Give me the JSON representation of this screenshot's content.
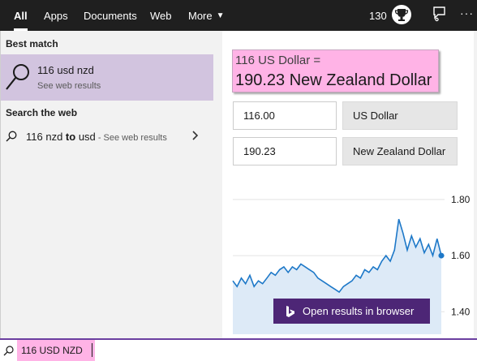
{
  "nav": {
    "tabs": [
      {
        "label": "All",
        "active": true
      },
      {
        "label": "Apps",
        "active": false
      },
      {
        "label": "Documents",
        "active": false
      },
      {
        "label": "Web",
        "active": false
      },
      {
        "label": "More",
        "active": false
      }
    ],
    "points": "130",
    "more_options": "···"
  },
  "left": {
    "best_match_title": "Best match",
    "best_item": {
      "title": "116 usd nzd",
      "subtitle": "See web results"
    },
    "search_web_title": "Search the web",
    "web_item": {
      "query_prefix": "116 nzd ",
      "query_bold": "to",
      "query_suffix": " usd",
      "subtitle": " - See web results"
    }
  },
  "converter": {
    "result_line1": "116 US Dollar =",
    "result_line2": "190.23 New Zealand Dollar",
    "from_amount": "116.00",
    "from_currency": "US Dollar",
    "to_amount": "190.23",
    "to_currency": "New Zealand Dollar"
  },
  "chart_data": {
    "type": "line",
    "title": "",
    "xlabel": "",
    "ylabel": "",
    "ylim": [
      1.32,
      1.84
    ],
    "yticks": [
      "1.80",
      "1.60",
      "1.40"
    ],
    "series": [
      {
        "values": [
          1.51,
          1.49,
          1.52,
          1.5,
          1.53,
          1.49,
          1.51,
          1.5,
          1.52,
          1.54,
          1.53,
          1.55,
          1.56,
          1.54,
          1.56,
          1.55,
          1.57,
          1.56,
          1.55,
          1.54,
          1.52,
          1.51,
          1.5,
          1.49,
          1.48,
          1.47,
          1.49,
          1.5,
          1.51,
          1.53,
          1.52,
          1.55,
          1.54,
          1.56,
          1.55,
          1.58,
          1.6,
          1.58,
          1.62,
          1.73,
          1.68,
          1.62,
          1.67,
          1.63,
          1.66,
          1.61,
          1.64,
          1.6,
          1.66,
          1.6
        ],
        "last_value": 1.6
      }
    ],
    "line_color": "#1d78c8",
    "fill_color": "#ddeaf7"
  },
  "open_button_label": "Open results in browser",
  "search": {
    "value": "116 USD NZD"
  },
  "colors": {
    "accent": "#6b3fa0",
    "selected_item": "#d2c4df",
    "highlight": "#ffb3e6",
    "button": "#4d2676"
  }
}
